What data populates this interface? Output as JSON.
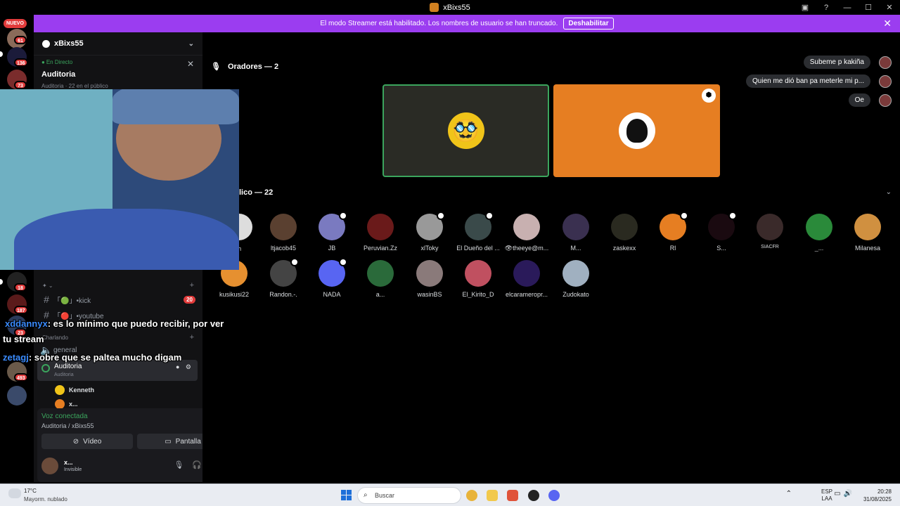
{
  "window": {
    "title": "xBixs55",
    "controls": [
      "—",
      "☐",
      "✕"
    ]
  },
  "banner": {
    "text": "El modo Streamer está habilitado. Los nombres de usuario se han truncado.",
    "button": "Deshabilitar"
  },
  "rail": {
    "nuevo": "NUEVO",
    "badges": [
      "61",
      "136",
      "73",
      "18",
      "187",
      "23",
      "493"
    ]
  },
  "sidebar": {
    "server_name": "xBixs55",
    "event": {
      "status": "En Directo",
      "title": "Auditoria",
      "subtitle": "Auditoria · 22 en el público"
    },
    "channels": [
      {
        "label": "「🟢」•kick",
        "badge": "20"
      },
      {
        "label": "「🔴」•youtube"
      }
    ],
    "category": "Charlando",
    "general": "general",
    "voice_channel": {
      "name": "Auditoria",
      "sub": "Auditoria"
    },
    "voice_users": [
      "Kenneth",
      "x..."
    ]
  },
  "voice_panel": {
    "status": "Voz conectada",
    "location": "Auditoria / xBixs55",
    "video_label": "Vídeo",
    "screen_label": "Pantalla"
  },
  "user": {
    "name": "x...",
    "status": "Invisible"
  },
  "stage": {
    "speakers_header": "Oradores — 2",
    "public_header": "lico — 22",
    "audience_row1": [
      "ㄱ",
      "ltjacob45",
      "JB",
      "Peruvian.Zz",
      "xlToky",
      "El Dueño del ...",
      "👁theeye@m...",
      "M...",
      "zaskexx",
      "Rl",
      "S...",
      "SIACFR",
      "_...",
      "Milanesa"
    ],
    "audience_row2": [
      "kusikusi22",
      "Randon.-.",
      "NADA",
      "a...",
      "wasinBS",
      "El_Kirito_D",
      "elcarameropr...",
      "Zudokato"
    ]
  },
  "chat_bubbles": [
    "Subeme p kakiña",
    "Quien me dió ban pa meterle mi p...",
    "Oe"
  ],
  "overlay_chat": [
    {
      "user": "xddannyx",
      "msg": ": es lo mínimo que puedo recibir, por ver",
      "cont": "tu stream"
    },
    {
      "user": "zetagj",
      "msg": ": sobre que se paltea mucho digam"
    }
  ],
  "taskbar": {
    "temp": "17°C",
    "weather": "Mayorm. nublado",
    "search": "Buscar",
    "lang1": "ESP",
    "lang2": "LAA",
    "time": "20:28",
    "date": "31/08/2025"
  },
  "colors": {
    "accent": "#9b3df0",
    "online": "#3ba55d",
    "badge": "#e13b3b",
    "speaker_tile": "#e67e22"
  }
}
